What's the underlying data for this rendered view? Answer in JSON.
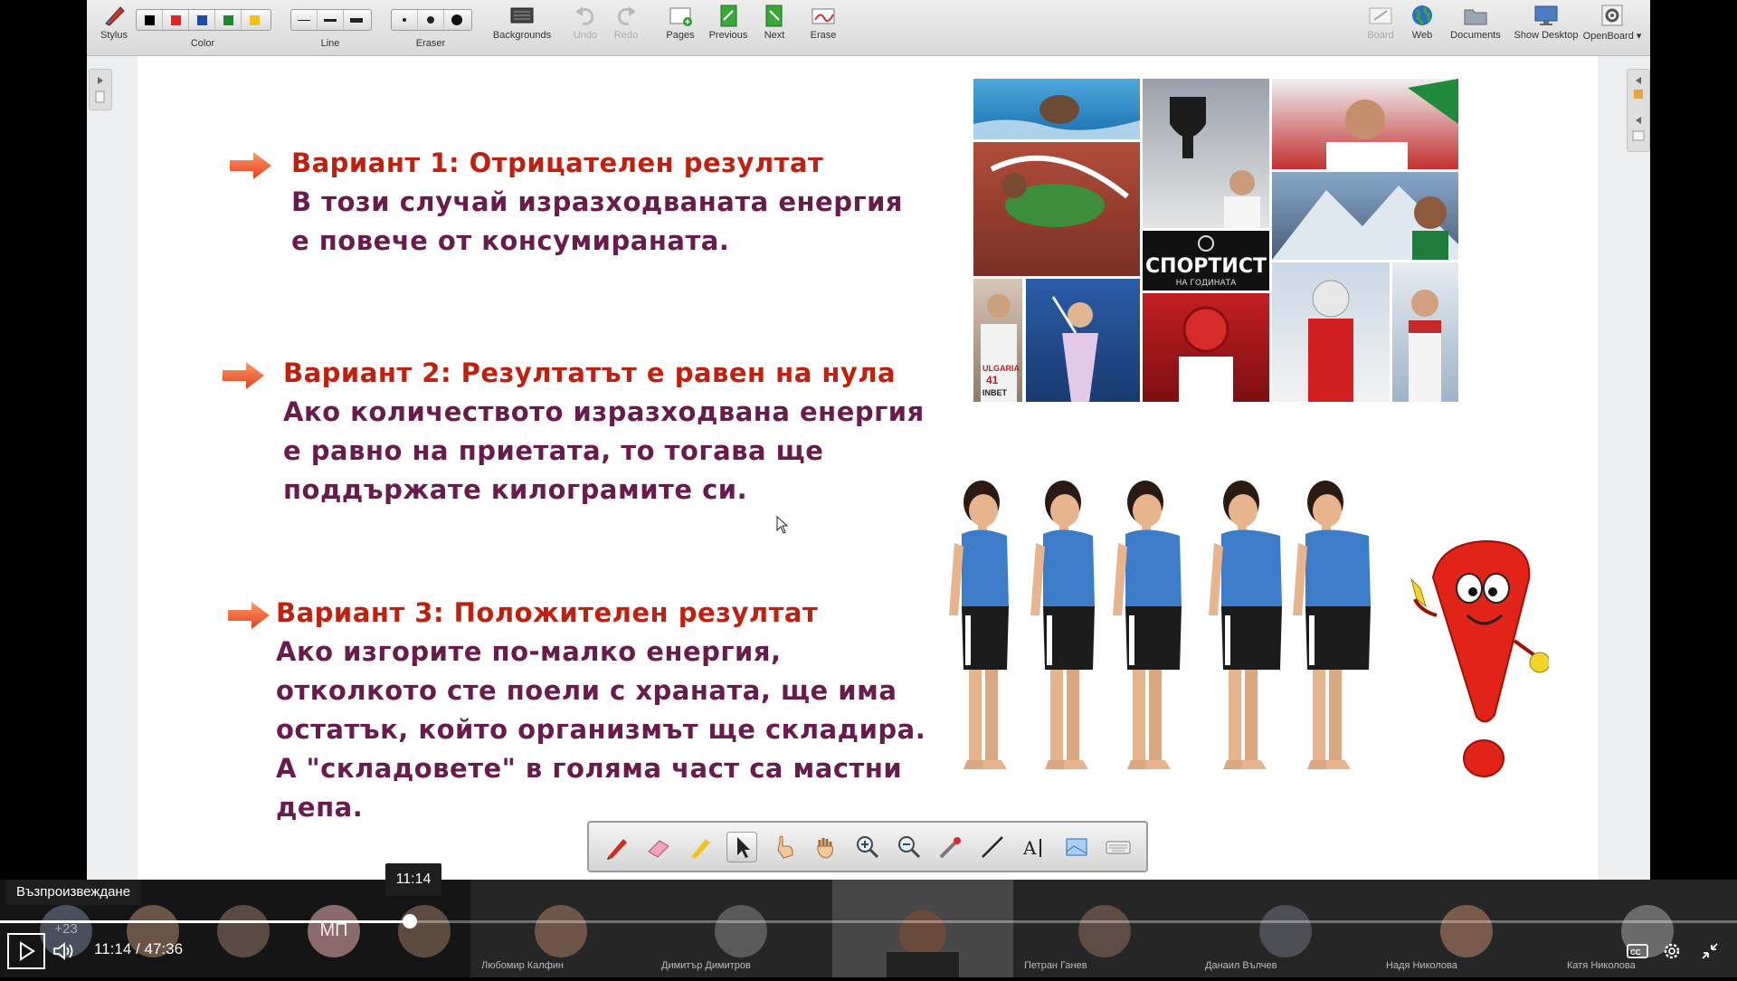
{
  "toolbar": {
    "stylus": "Stylus",
    "color": "Color",
    "line": "Line",
    "eraser": "Eraser",
    "backgrounds": "Backgrounds",
    "undo": "Undo",
    "redo": "Redo",
    "pages": "Pages",
    "previous": "Previous",
    "next": "Next",
    "erase": "Erase",
    "board": "Board",
    "web": "Web",
    "documents": "Documents",
    "show_desktop": "Show Desktop",
    "openboard": "OpenBoard",
    "colors": [
      "#000000",
      "#e8231b",
      "#1a4fa8",
      "#1a8a2a",
      "#f1c21b"
    ]
  },
  "slide": {
    "variant1_title": "Вариант 1: Отрицателен резултат",
    "variant1_body": "В този случай изразходваната енергия е повече от консумираната.",
    "variant2_title": "Вариант 2: Резултатът е равен на нула",
    "variant2_body": "Ако количеството изразходвана енергия е равно на приетата, то тогава ще поддържате килограмите си.",
    "variant3_title": "Вариант 3: Положителен резултат",
    "variant3_body": "Ако изгорите по-малко енергия, отколкото сте поели с храната, ще има остатък, който организмът ще складира. А \"складовете\" в голяма част са мастни депа.",
    "collage_logo_line1": "СПОРТИСТ",
    "collage_logo_line2": "НА ГОДИНАТА",
    "jersey_text": "ULGARIA",
    "jersey_number": "41",
    "jersey_sponsor": "INBET",
    "title_color": "#c0210f",
    "body_color": "#6b1a4c"
  },
  "player": {
    "play_tooltip": "Възпроизвеждане",
    "time_tooltip": "11:14",
    "current_time": "11:14",
    "separator": "/",
    "duration": "47:36",
    "progress_fraction": 0.2358,
    "extra_count": "+23",
    "initials": "МП",
    "participants": [
      "Любомир Калфин",
      "Димитър Димитров",
      "Петран Ганев",
      "Данаил Вълчев",
      "Надя Николова",
      "Катя Николова"
    ]
  }
}
